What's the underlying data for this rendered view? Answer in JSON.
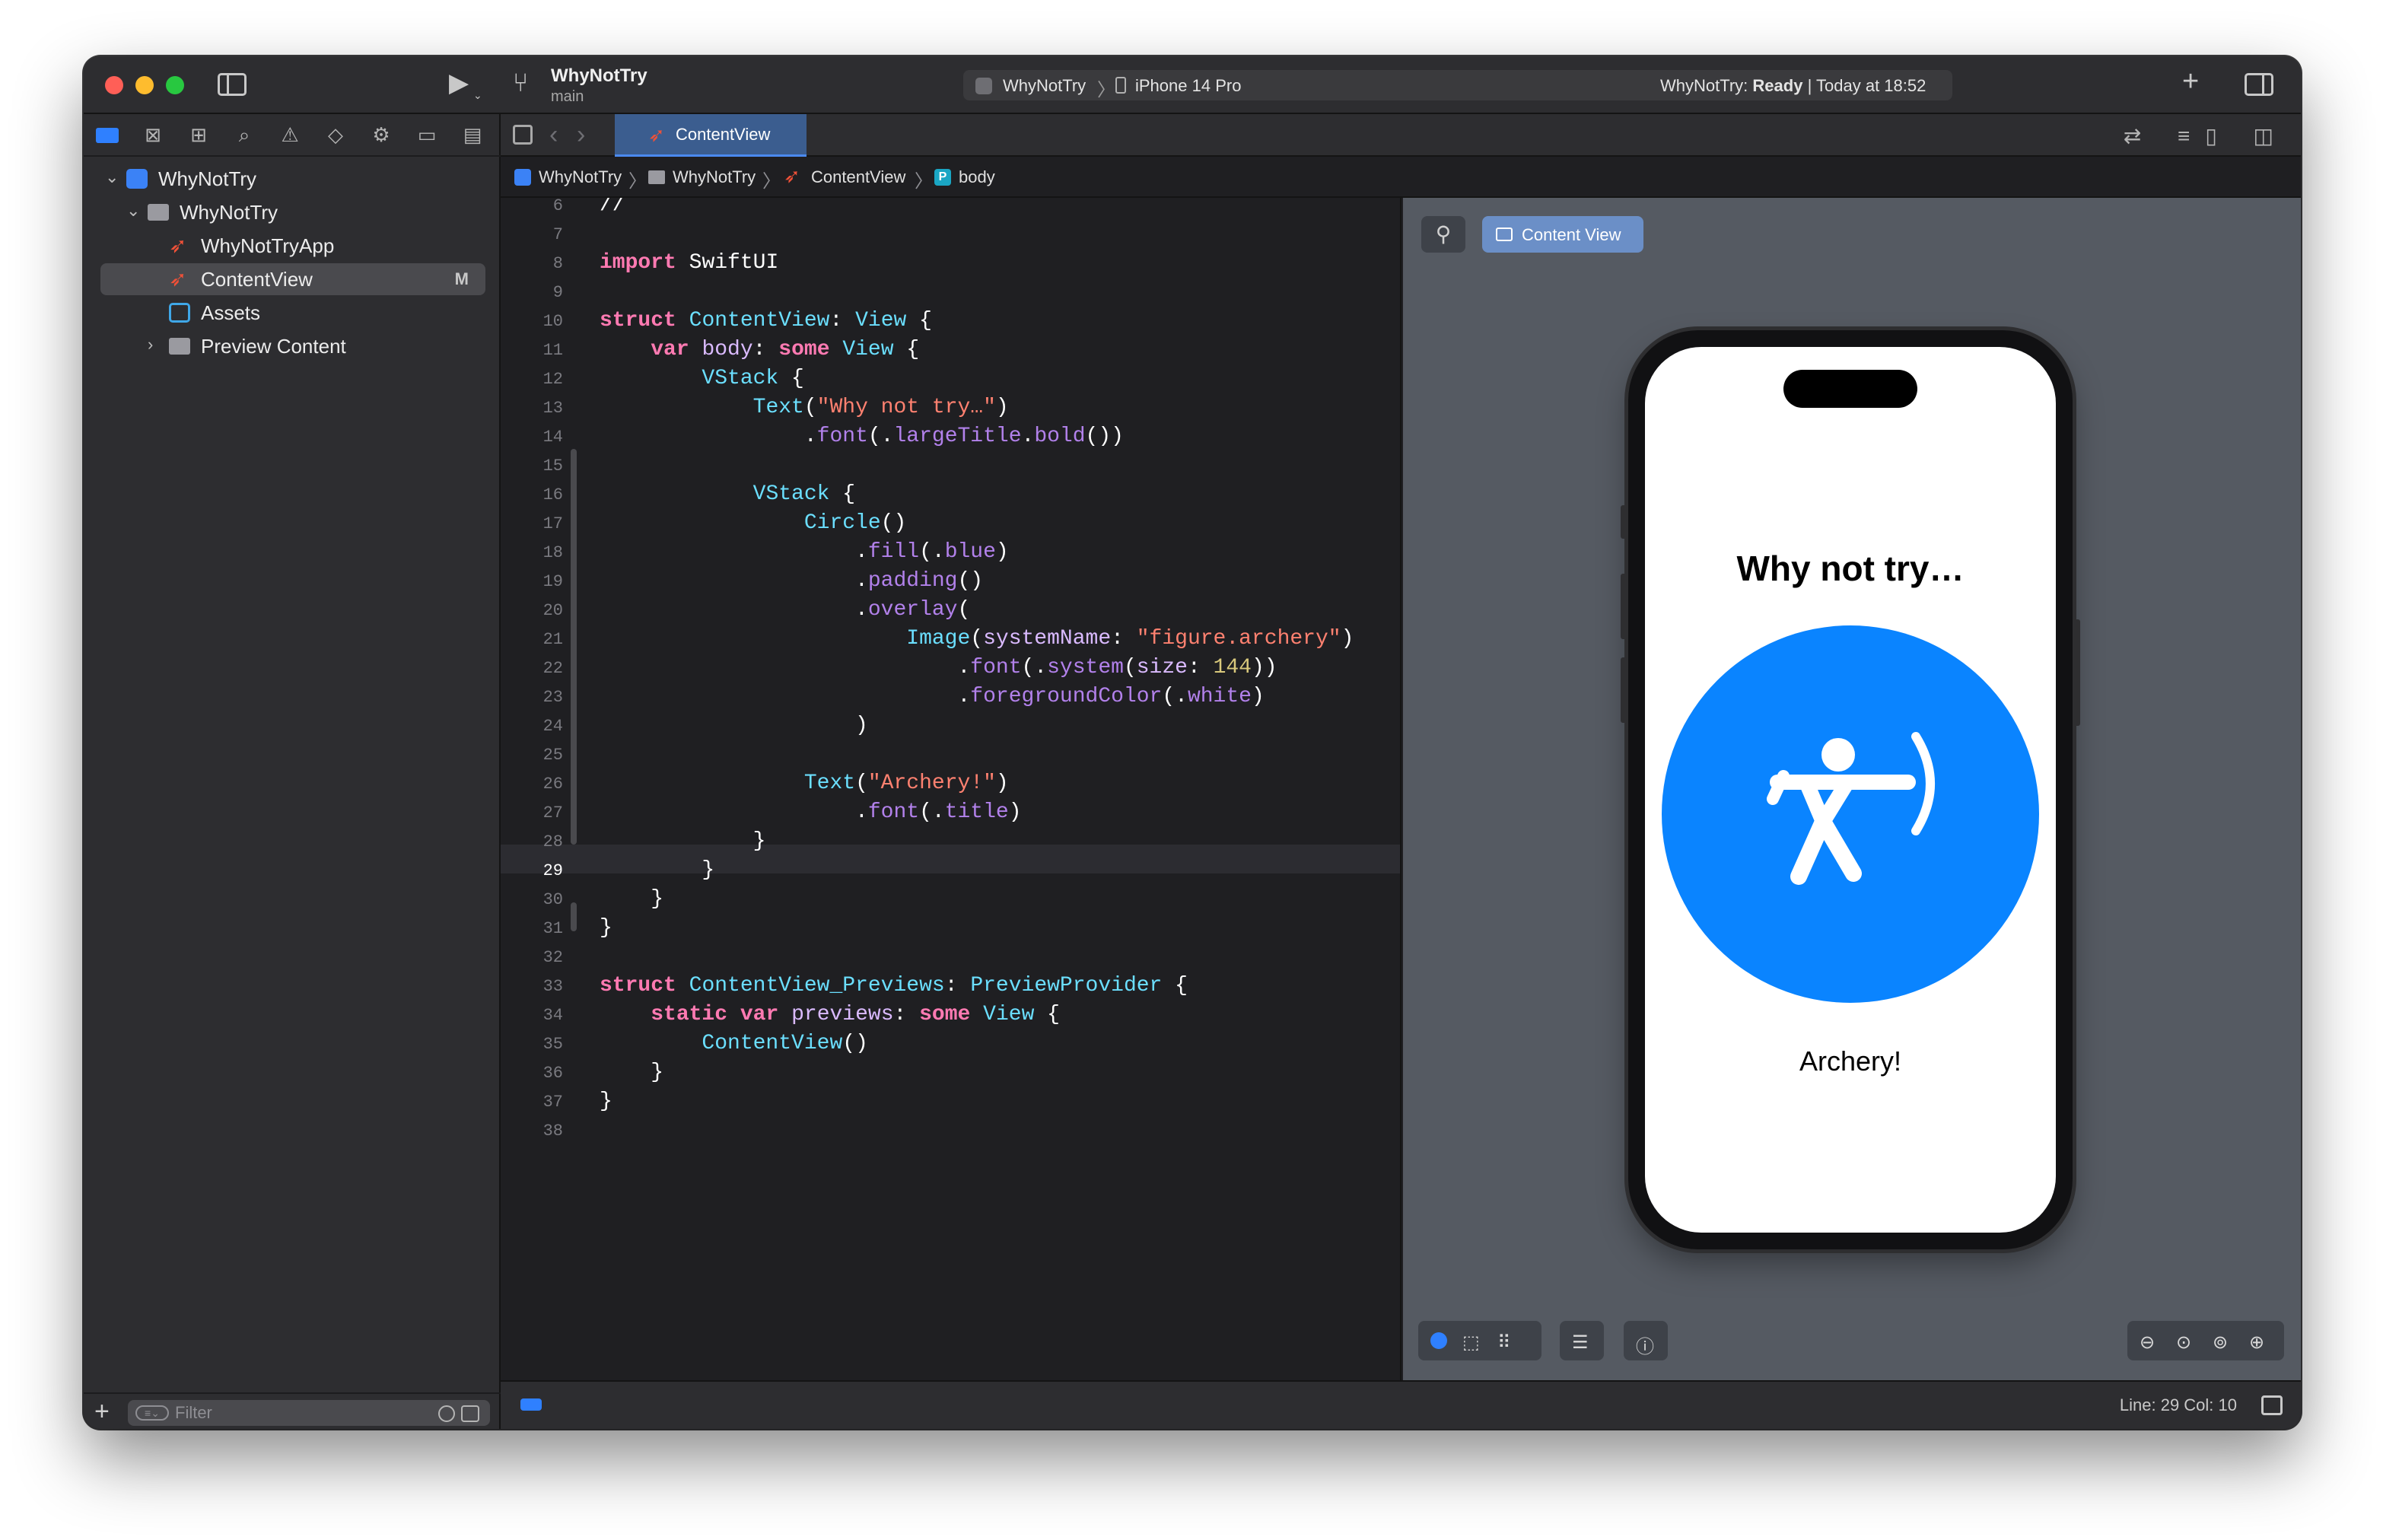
{
  "window": {
    "project_title": "WhyNotTry",
    "branch": "main",
    "scheme_app": "WhyNotTry",
    "scheme_separator": "〉",
    "scheme_device": "iPhone 14 Pro",
    "status_app": "WhyNotTry:",
    "status_state": "Ready",
    "status_time": "| Today at 18:52"
  },
  "navigator": {
    "items": [
      {
        "label": "WhyNotTry",
        "kind": "project",
        "expanded": true
      },
      {
        "label": "WhyNotTry",
        "kind": "folder",
        "expanded": true
      },
      {
        "label": "WhyNotTryApp",
        "kind": "swift-file"
      },
      {
        "label": "ContentView",
        "kind": "swift-file",
        "selected": true,
        "badge": "M"
      },
      {
        "label": "Assets",
        "kind": "asset-catalog"
      },
      {
        "label": "Preview Content",
        "kind": "folder",
        "expanded": false
      }
    ],
    "filter_placeholder": "Filter"
  },
  "editor": {
    "tab_label": "ContentView",
    "jumpbar": [
      "WhyNotTry",
      "WhyNotTry",
      "ContentView",
      "body"
    ],
    "jumpbar_body_icon": "P",
    "current_line": 29,
    "lines": [
      {
        "n": "6",
        "text": "//"
      },
      {
        "n": "7",
        "text": ""
      },
      {
        "n": "8",
        "text": "import SwiftUI"
      },
      {
        "n": "9",
        "text": ""
      },
      {
        "n": "10",
        "text": "struct ContentView: View {"
      },
      {
        "n": "11",
        "text": "    var body: some View {"
      },
      {
        "n": "12",
        "text": "        VStack {"
      },
      {
        "n": "13",
        "text": "            Text(\"Why not try…\")"
      },
      {
        "n": "14",
        "text": "                .font(.largeTitle.bold())"
      },
      {
        "n": "15",
        "text": ""
      },
      {
        "n": "16",
        "text": "            VStack {"
      },
      {
        "n": "17",
        "text": "                Circle()"
      },
      {
        "n": "18",
        "text": "                    .fill(.blue)"
      },
      {
        "n": "19",
        "text": "                    .padding()"
      },
      {
        "n": "20",
        "text": "                    .overlay("
      },
      {
        "n": "21",
        "text": "                        Image(systemName: \"figure.archery\")"
      },
      {
        "n": "22",
        "text": "                            .font(.system(size: 144))"
      },
      {
        "n": "23",
        "text": "                            .foregroundColor(.white)"
      },
      {
        "n": "24",
        "text": "                    )"
      },
      {
        "n": "25",
        "text": ""
      },
      {
        "n": "26",
        "text": "                Text(\"Archery!\")"
      },
      {
        "n": "27",
        "text": "                    .font(.title)"
      },
      {
        "n": "28",
        "text": "            }"
      },
      {
        "n": "29",
        "text": "        }"
      },
      {
        "n": "30",
        "text": "    }"
      },
      {
        "n": "31",
        "text": "}"
      },
      {
        "n": "32",
        "text": ""
      },
      {
        "n": "33",
        "text": "struct ContentView_Previews: PreviewProvider {"
      },
      {
        "n": "34",
        "text": "    static var previews: some View {"
      },
      {
        "n": "35",
        "text": "        ContentView()"
      },
      {
        "n": "36",
        "text": "    }"
      },
      {
        "n": "37",
        "text": "}"
      },
      {
        "n": "38",
        "text": ""
      }
    ]
  },
  "preview": {
    "chip_label": "Content View",
    "screen_title": "Why not try…",
    "screen_caption": "Archery!",
    "circle_color": "#0a84ff",
    "icon": "figure-archery-icon"
  },
  "statusbar": {
    "cursor": "Line: 29  Col: 10"
  },
  "colors": {
    "accent": "#2f80ff",
    "keyword": "#ff7ab2",
    "type": "#6bdfff",
    "string": "#ff8170",
    "number": "#d9c97c",
    "method": "#b281eb"
  }
}
